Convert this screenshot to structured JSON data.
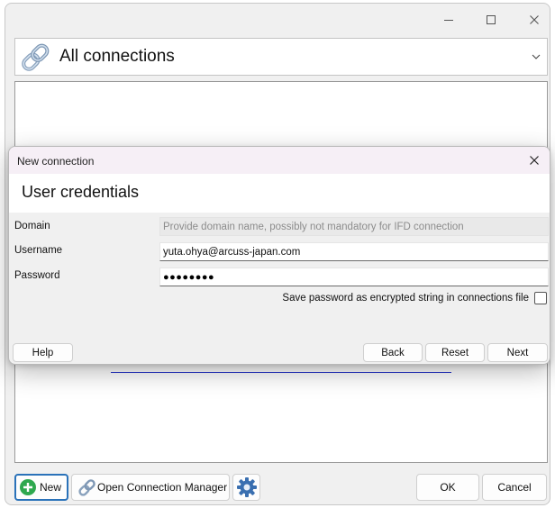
{
  "main_window": {
    "titlebar": {
      "minimize_icon": "minimize-icon",
      "maximize_icon": "maximize-icon",
      "close_icon": "close-icon"
    },
    "connections_combo": {
      "icon": "chain-link-icon",
      "selected": "All connections"
    },
    "buttons": {
      "new": "New",
      "open_connection_manager": "Open Connection Manager",
      "ok": "OK",
      "cancel": "Cancel"
    }
  },
  "dialog": {
    "title": "New connection",
    "heading": "User credentials",
    "fields": {
      "domain": {
        "label": "Domain",
        "placeholder": "Provide domain name, possibly not mandatory for IFD connection",
        "value": ""
      },
      "username": {
        "label": "Username",
        "value": "yuta.ohya@arcuss-japan.com"
      },
      "password": {
        "label": "Password",
        "masked_value": "●●●●●●●●"
      }
    },
    "save_password": {
      "label": "Save password as encrypted string in connections file",
      "checked": false
    },
    "buttons": {
      "help": "Help",
      "back": "Back",
      "reset": "Reset",
      "next": "Next"
    }
  },
  "colors": {
    "accent_blue": "#2a72b9",
    "new_icon_green": "#2fa84f",
    "gear_blue": "#3a6fb0",
    "link_blue": "#2433c9"
  }
}
